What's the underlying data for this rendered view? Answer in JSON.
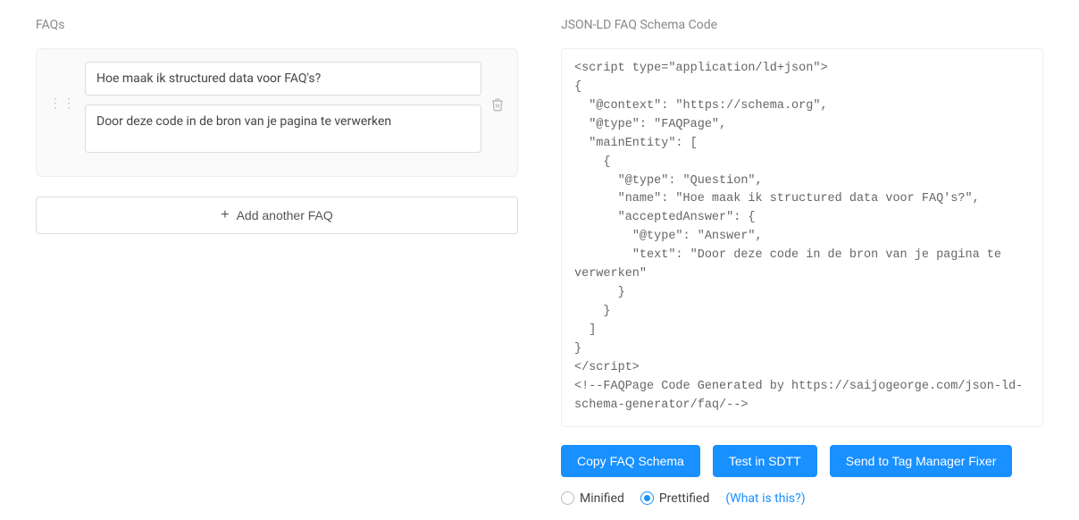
{
  "left": {
    "title": "FAQs",
    "faq": {
      "question": "Hoe maak ik structured data voor FAQ's?",
      "answer": "Door deze code in de bron van je pagina te verwerken"
    },
    "add_button": "Add another FAQ"
  },
  "right": {
    "title": "JSON-LD FAQ Schema Code",
    "code": "<script type=\"application/ld+json\">\n{\n  \"@context\": \"https://schema.org\",\n  \"@type\": \"FAQPage\",\n  \"mainEntity\": [\n    {\n      \"@type\": \"Question\",\n      \"name\": \"Hoe maak ik structured data voor FAQ's?\",\n      \"acceptedAnswer\": {\n        \"@type\": \"Answer\",\n        \"text\": \"Door deze code in de bron van je pagina te verwerken\"\n      }\n    }\n  ]\n}\n</script>\n<!--FAQPage Code Generated by https://saijogeorge.com/json-ld-schema-generator/faq/-->",
    "buttons": {
      "copy": "Copy FAQ Schema",
      "test": "Test in SDTT",
      "send": "Send to Tag Manager Fixer"
    },
    "format": {
      "minified": "Minified",
      "prettified": "Prettified",
      "help": "(What is this?)"
    }
  }
}
